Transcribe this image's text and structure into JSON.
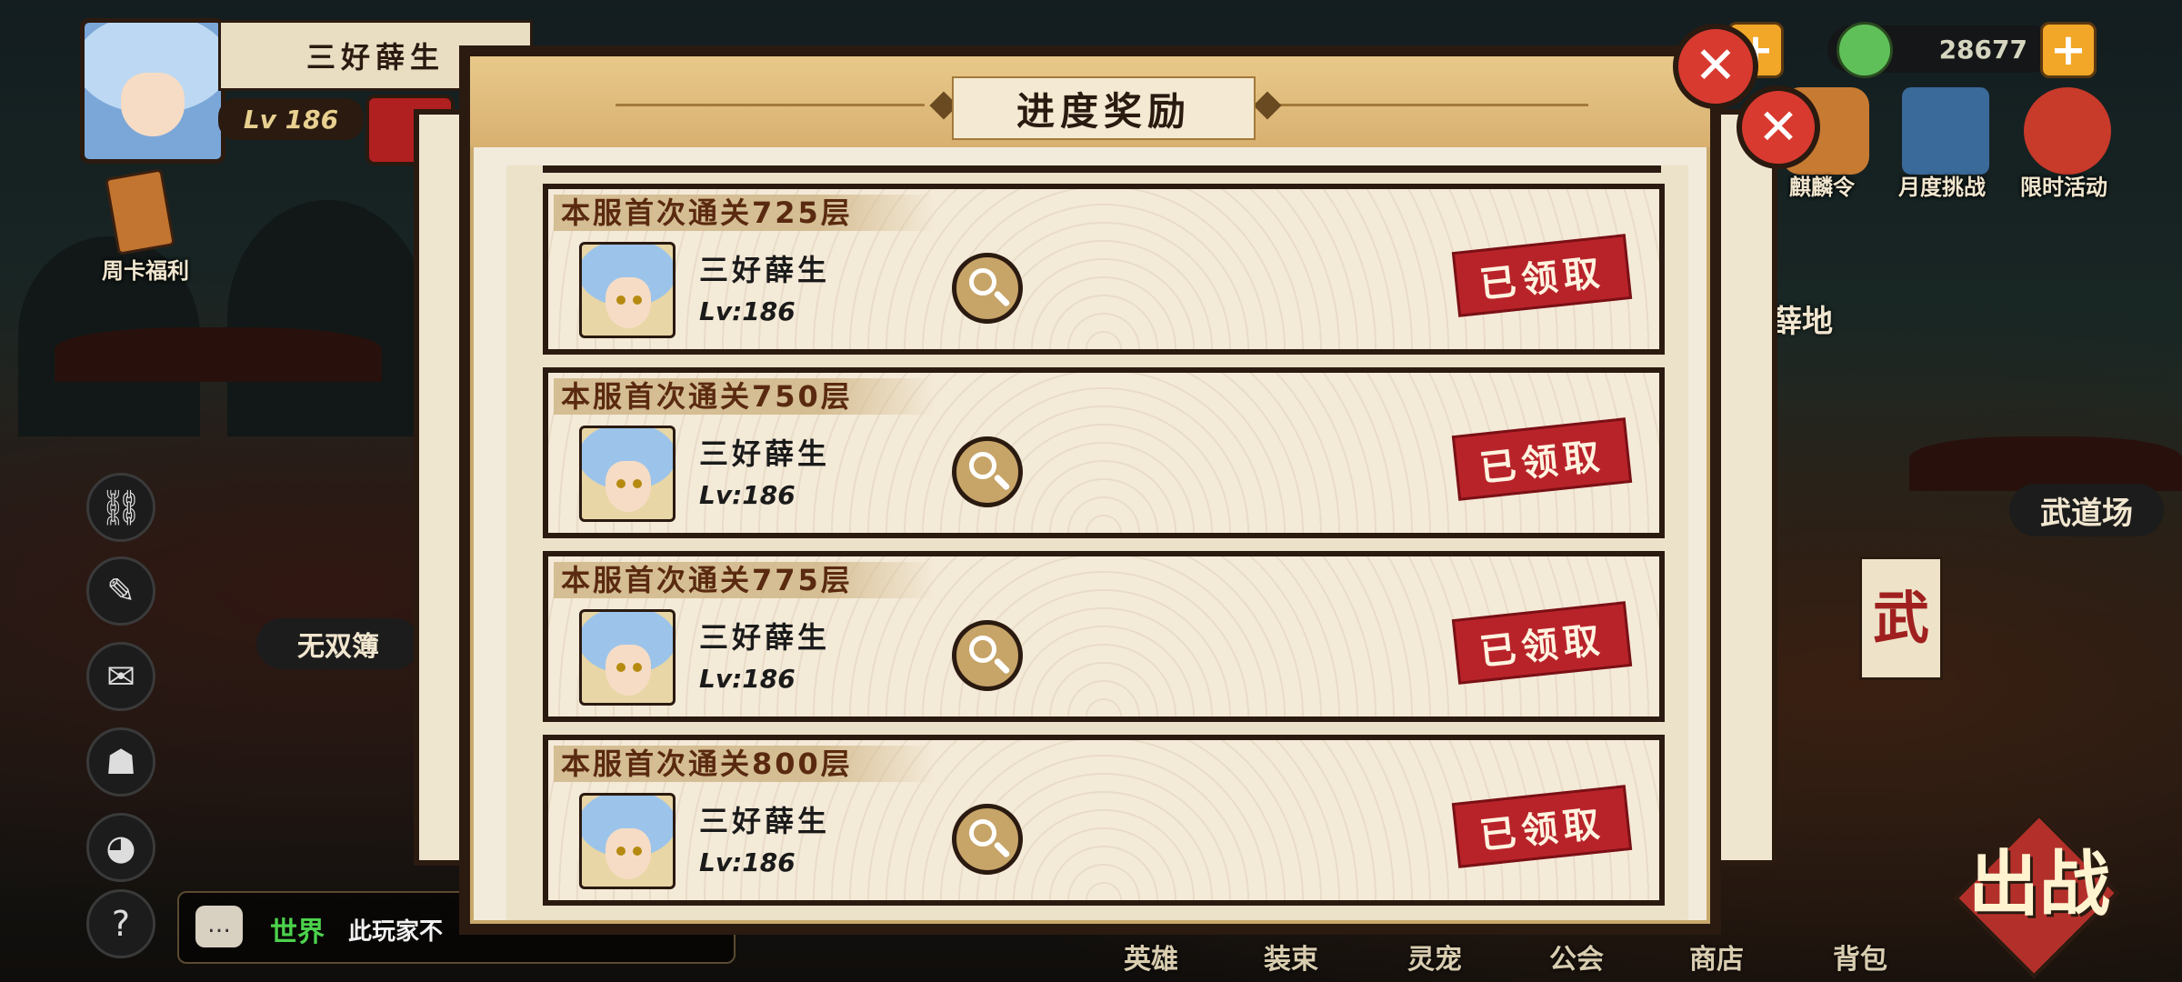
{
  "player": {
    "name": "三好薛生",
    "level": "Lv 186"
  },
  "side_menu": {
    "weekly_card": "周卡福利",
    "wushuang": "无双簿"
  },
  "chat": {
    "channel": "世界",
    "message": "此玩家不"
  },
  "currency": {
    "amount": "28677"
  },
  "top_menu": [
    {
      "label": "麒麟令"
    },
    {
      "label": "月度挑战"
    },
    {
      "label": "限时活动"
    }
  ],
  "scene": {
    "field_label": "薛地",
    "dojo_label": "武道场",
    "banner": "武",
    "battle_button": "出战"
  },
  "bottom_nav": [
    {
      "label": "英雄"
    },
    {
      "label": "装束"
    },
    {
      "label": "灵宠"
    },
    {
      "label": "公会"
    },
    {
      "label": "商店"
    },
    {
      "label": "背包"
    }
  ],
  "dialog": {
    "title": "进度奖励",
    "rows": [
      {
        "title": "本服首次通关725层",
        "player_name": "三好薛生",
        "player_level": "Lv:186",
        "status": "已领取"
      },
      {
        "title": "本服首次通关750层",
        "player_name": "三好薛生",
        "player_level": "Lv:186",
        "status": "已领取"
      },
      {
        "title": "本服首次通关775层",
        "player_name": "三好薛生",
        "player_level": "Lv:186",
        "status": "已领取"
      },
      {
        "title": "本服首次通关800层",
        "player_name": "三好薛生",
        "player_level": "Lv:186",
        "status": "已领取"
      }
    ]
  },
  "colors": {
    "stamp_red": "#b8232a",
    "close_red": "#d83a30",
    "frame_dark": "#2a1a10",
    "header_gold": "#e8c98a"
  }
}
